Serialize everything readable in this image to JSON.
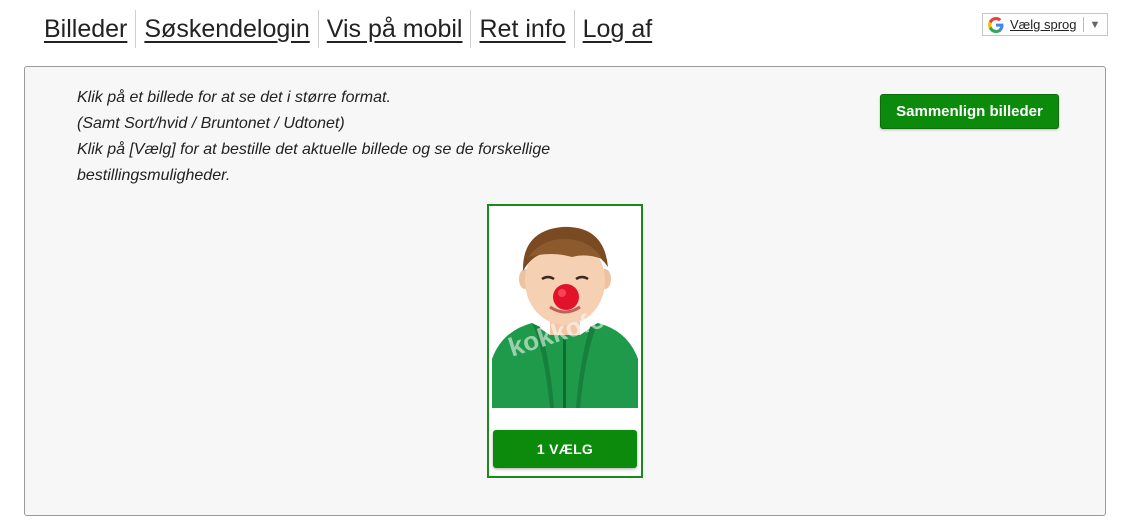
{
  "nav": {
    "items": [
      {
        "label": "Billeder"
      },
      {
        "label": "Søskendelogin"
      },
      {
        "label": "Vis på mobil"
      },
      {
        "label": "Ret info"
      },
      {
        "label": "Log af"
      }
    ]
  },
  "language": {
    "label": "Vælg sprog",
    "icon": "google-g-icon",
    "caret": "▼"
  },
  "instructions": {
    "line1": "Klik på et billede for at se det i større format.",
    "line2": "(Samt Sort/hvid / Bruntonet / Udtonet)",
    "line3": "Klik på [Vælg] for at bestille det aktuelle billede og se de forskellige bestillingsmuligheder."
  },
  "compare_button": "Sammenlign billeder",
  "photos": [
    {
      "choose_label": "1 VÆLG",
      "watermark": "kokkofoto"
    }
  ],
  "colors": {
    "accent_green": "#0c8a0c",
    "card_border": "#1a8a1a"
  }
}
